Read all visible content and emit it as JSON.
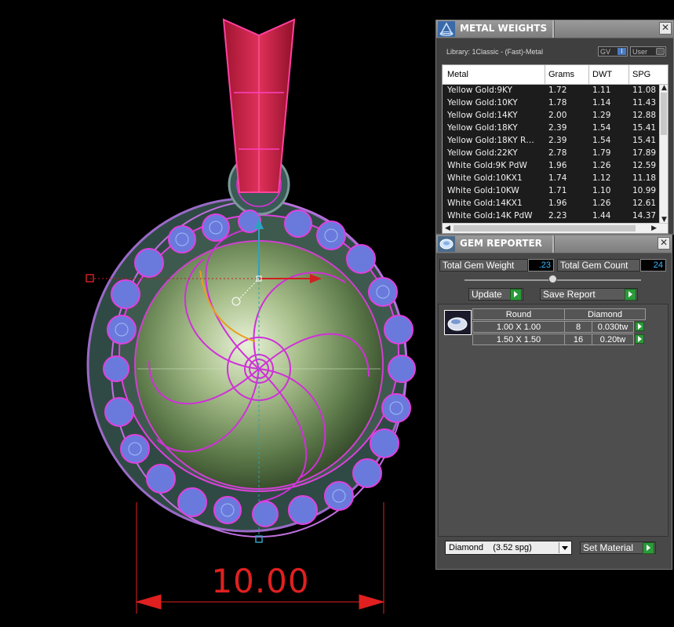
{
  "viewport": {
    "dimension_value": "10.00"
  },
  "metal_weights": {
    "title": "METAL WEIGHTS",
    "library_label": "Library: 1Classic - (Fast)-Metal",
    "gv_toggle": "GV",
    "gv_indicator": "I",
    "user_toggle": "User",
    "columns": [
      "Metal",
      "Grams",
      "DWT",
      "SPG"
    ],
    "rows": [
      {
        "metal": "Yellow Gold:9KY",
        "grams": "1.72",
        "dwt": "1.11",
        "spg": "11.08"
      },
      {
        "metal": "Yellow Gold:10KY",
        "grams": "1.78",
        "dwt": "1.14",
        "spg": "11.43"
      },
      {
        "metal": "Yellow Gold:14KY",
        "grams": "2.00",
        "dwt": "1.29",
        "spg": "12.88"
      },
      {
        "metal": "Yellow Gold:18KY",
        "grams": "2.39",
        "dwt": "1.54",
        "spg": "15.41"
      },
      {
        "metal": "Yellow Gold:18KY R…",
        "grams": "2.39",
        "dwt": "1.54",
        "spg": "15.41"
      },
      {
        "metal": "Yellow Gold:22KY",
        "grams": "2.78",
        "dwt": "1.79",
        "spg": "17.89"
      },
      {
        "metal": "White Gold:9K PdW",
        "grams": "1.96",
        "dwt": "1.26",
        "spg": "12.59"
      },
      {
        "metal": "White Gold:10KX1",
        "grams": "1.74",
        "dwt": "1.12",
        "spg": "11.18"
      },
      {
        "metal": "White Gold:10KW",
        "grams": "1.71",
        "dwt": "1.10",
        "spg": "10.99"
      },
      {
        "metal": "White Gold:14KX1",
        "grams": "1.96",
        "dwt": "1.26",
        "spg": "12.61"
      },
      {
        "metal": "White Gold:14K PdW",
        "grams": "2.23",
        "dwt": "1.44",
        "spg": "14.37"
      }
    ]
  },
  "gem_reporter": {
    "title": "GEM REPORTER",
    "total_weight_label": "Total Gem Weight",
    "total_weight_value": ".23",
    "total_count_label": "Total Gem Count",
    "total_count_value": "24",
    "update_label": "Update",
    "save_report_label": "Save Report",
    "table_headers": [
      "Round",
      "Diamond"
    ],
    "rows": [
      {
        "size": "1.00 X 1.00",
        "count": "8",
        "weight": "0.030tw"
      },
      {
        "size": "1.50 X 1.50",
        "count": "16",
        "weight": "0.20tw"
      }
    ],
    "material_select": "Diamond    (3.52 spg)",
    "set_material_label": "Set Material"
  }
}
